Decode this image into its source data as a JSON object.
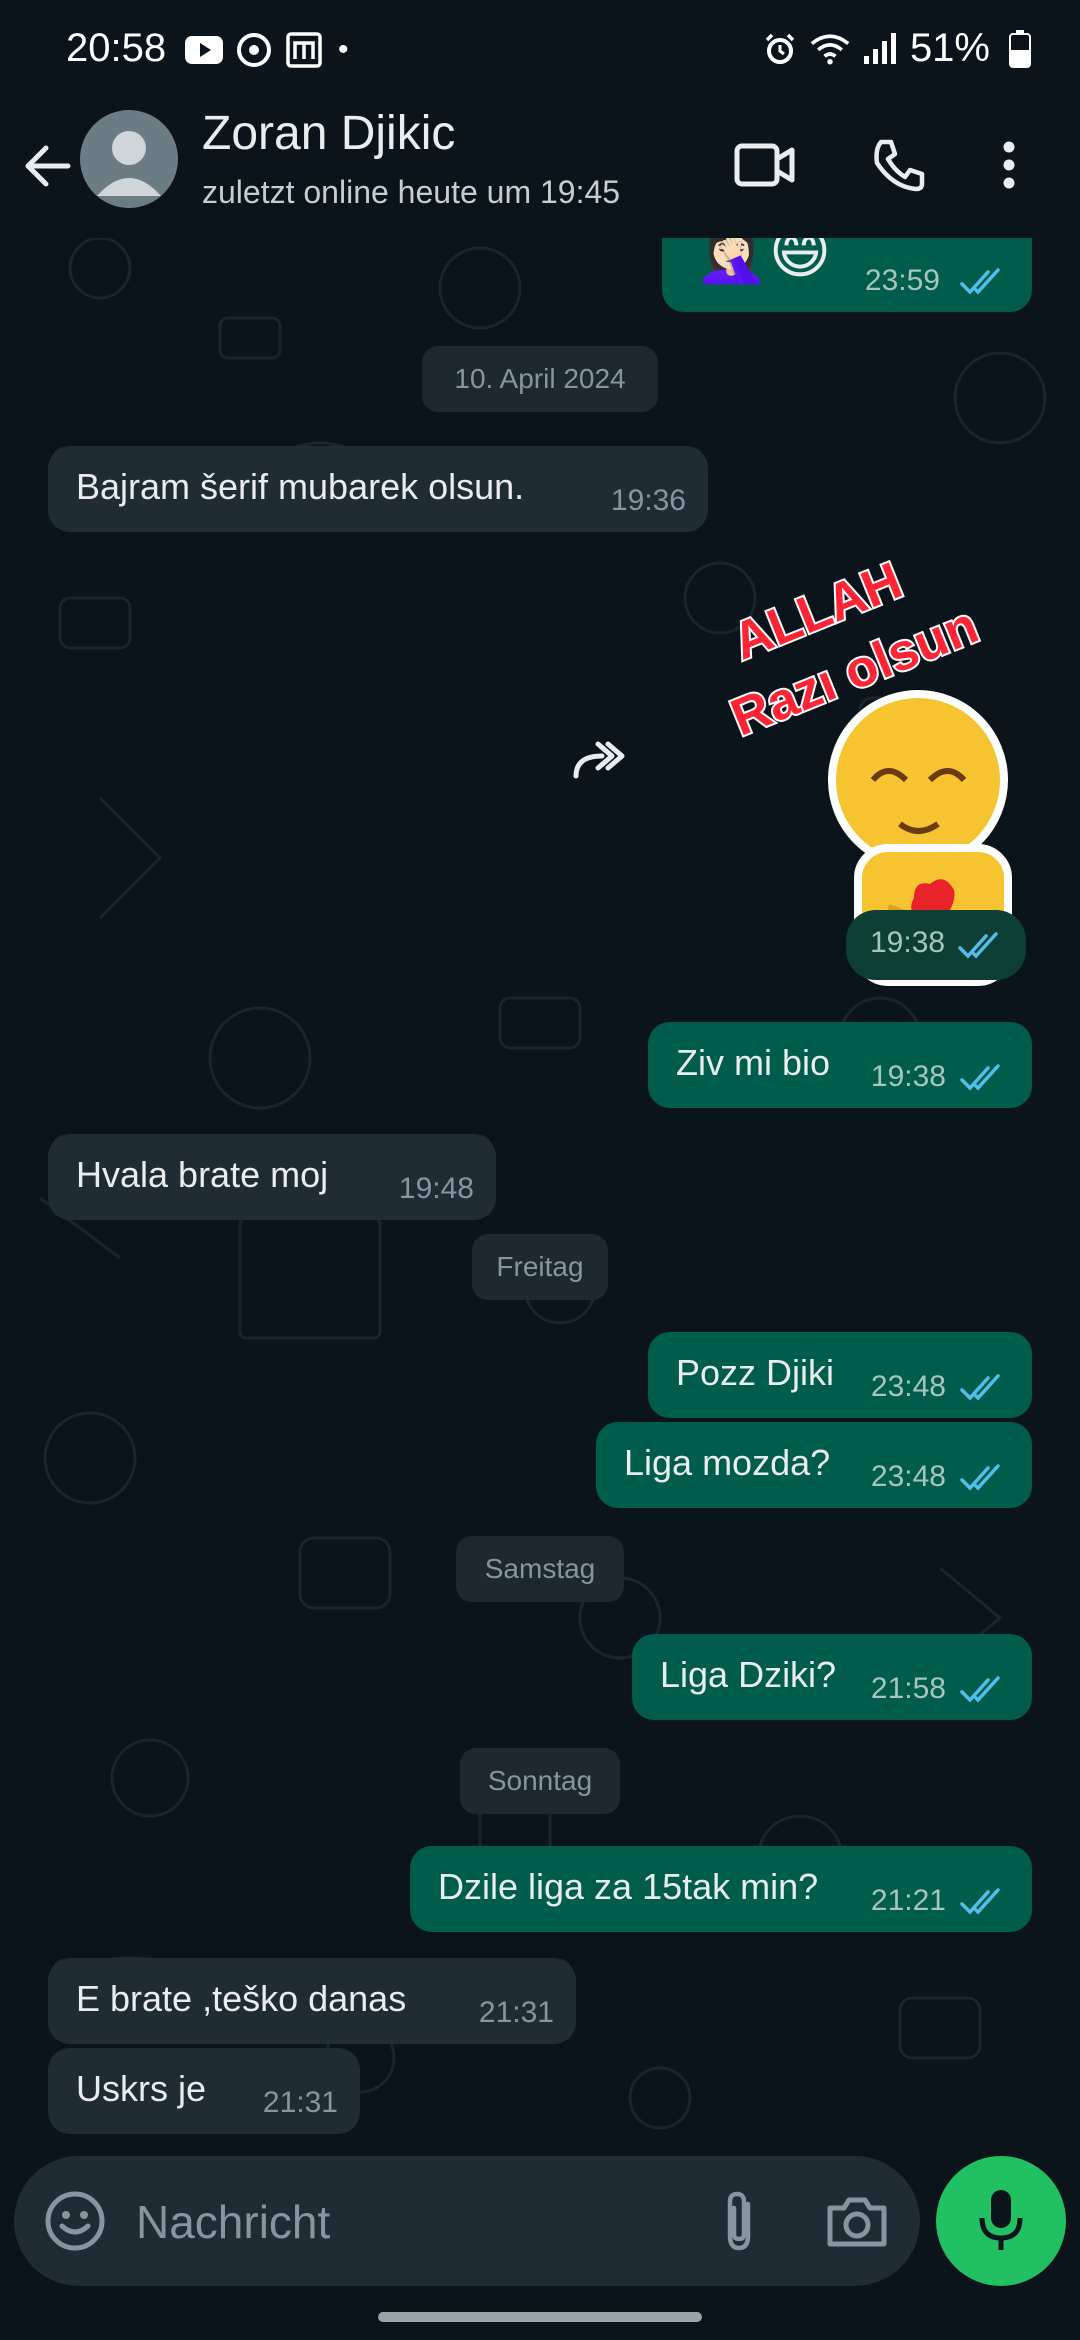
{
  "status_bar": {
    "time": "20:58",
    "dot": "•",
    "battery": "51%"
  },
  "header": {
    "contact_name": "Zoran Djikic",
    "contact_status": "zuletzt online heute um 19:45"
  },
  "messages": [
    {
      "dir": "out",
      "text": "",
      "time": "23:59",
      "ticks": "read"
    },
    {
      "dir": "date",
      "text": "10. April 2024"
    },
    {
      "dir": "in",
      "text": "Bajram šerif mubarek olsun.",
      "time": "19:36"
    },
    {
      "dir": "out",
      "sticker_text": [
        "ALLAH",
        "Razı olsun"
      ],
      "time": "19:38",
      "ticks": "read"
    },
    {
      "dir": "out",
      "text": "Ziv mi bio",
      "time": "19:38",
      "ticks": "read"
    },
    {
      "dir": "in",
      "text": "Hvala brate moj",
      "time": "19:48"
    },
    {
      "dir": "date",
      "text": "Freitag"
    },
    {
      "dir": "out",
      "text": "Pozz Djiki",
      "time": "23:48",
      "ticks": "read"
    },
    {
      "dir": "out",
      "text": "Liga mozda?",
      "time": "23:48",
      "ticks": "read"
    },
    {
      "dir": "date",
      "text": "Samstag"
    },
    {
      "dir": "out",
      "text": "Liga Dziki?",
      "time": "21:58",
      "ticks": "read"
    },
    {
      "dir": "date",
      "text": "Sonntag"
    },
    {
      "dir": "out",
      "text": "Dzile liga za 15tak min?",
      "time": "21:21",
      "ticks": "read"
    },
    {
      "dir": "in",
      "text": "E brate ,teško danas",
      "time": "21:31"
    },
    {
      "dir": "in",
      "text": "Uskrs je",
      "time": "21:31"
    }
  ],
  "composer": {
    "placeholder": "Nachricht"
  },
  "colors": {
    "background": "#0b141a",
    "outgoing_bubble": "#005c4b",
    "incoming_bubble": "#202c33",
    "read_ticks": "#53bdeb",
    "mic_button": "#21c063"
  },
  "icons": [
    "back-arrow-icon",
    "avatar-icon",
    "video-call-icon",
    "voice-call-icon",
    "more-options-icon",
    "forward-icon",
    "emoji-icon",
    "attach-icon",
    "camera-icon",
    "mic-icon",
    "double-check-icon"
  ]
}
